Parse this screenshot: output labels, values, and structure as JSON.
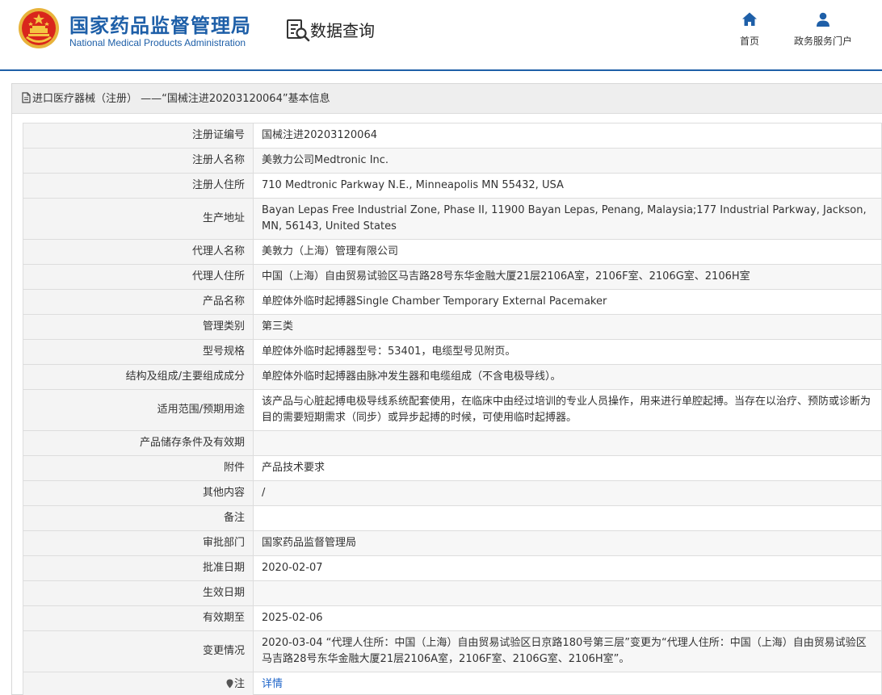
{
  "header": {
    "brand_cn": "国家药品监督管理局",
    "brand_en": "National Medical Products Administration",
    "query_title": "数据查询",
    "nav": [
      {
        "label": "首页",
        "icon": "home-icon"
      },
      {
        "label": "政务服务门户",
        "icon": "user-icon"
      }
    ]
  },
  "panel": {
    "title": "进口医疗器械（注册） ——“国械注进20203120064”基本信息"
  },
  "rows": [
    {
      "label": "注册证编号",
      "value": "国械注进20203120064"
    },
    {
      "label": "注册人名称",
      "value": "美敦力公司Medtronic Inc."
    },
    {
      "label": "注册人住所",
      "value": "710 Medtronic Parkway N.E., Minneapolis MN 55432, USA"
    },
    {
      "label": "生产地址",
      "value": "Bayan Lepas Free Industrial Zone, Phase II, 11900 Bayan Lepas, Penang, Malaysia;177 Industrial Parkway, Jackson, MN, 56143, United States"
    },
    {
      "label": "代理人名称",
      "value": "美敦力（上海）管理有限公司"
    },
    {
      "label": "代理人住所",
      "value": "中国（上海）自由贸易试验区马吉路28号东华金融大厦21层2106A室，2106F室、2106G室、2106H室"
    },
    {
      "label": "产品名称",
      "value": "单腔体外临时起搏器Single Chamber Temporary External Pacemaker"
    },
    {
      "label": "管理类别",
      "value": "第三类"
    },
    {
      "label": "型号规格",
      "value": "单腔体外临时起搏器型号：53401，电缆型号见附页。"
    },
    {
      "label": "结构及组成/主要组成成分",
      "value": "单腔体外临时起搏器由脉冲发生器和电缆组成（不含电极导线）。"
    },
    {
      "label": "适用范围/预期用途",
      "value": "该产品与心脏起搏电极导线系统配套使用，在临床中由经过培训的专业人员操作，用来进行单腔起搏。当存在以治疗、预防或诊断为目的需要短期需求（同步）或异步起搏的时候，可使用临时起搏器。"
    },
    {
      "label": "产品储存条件及有效期",
      "value": ""
    },
    {
      "label": "附件",
      "value": "产品技术要求"
    },
    {
      "label": "其他内容",
      "value": "/"
    },
    {
      "label": "备注",
      "value": ""
    },
    {
      "label": "审批部门",
      "value": "国家药品监督管理局"
    },
    {
      "label": "批准日期",
      "value": "2020-02-07"
    },
    {
      "label": "生效日期",
      "value": ""
    },
    {
      "label": "有效期至",
      "value": "2025-02-06"
    },
    {
      "label": "变更情况",
      "value": "2020-03-04 “代理人住所：中国（上海）自由贸易试验区日京路180号第三层”变更为“代理人住所：中国（上海）自由贸易试验区马吉路28号东华金融大厦21层2106A室，2106F室、2106G室、2106H室”。"
    }
  ],
  "note": {
    "label": "注",
    "link": "详情"
  }
}
